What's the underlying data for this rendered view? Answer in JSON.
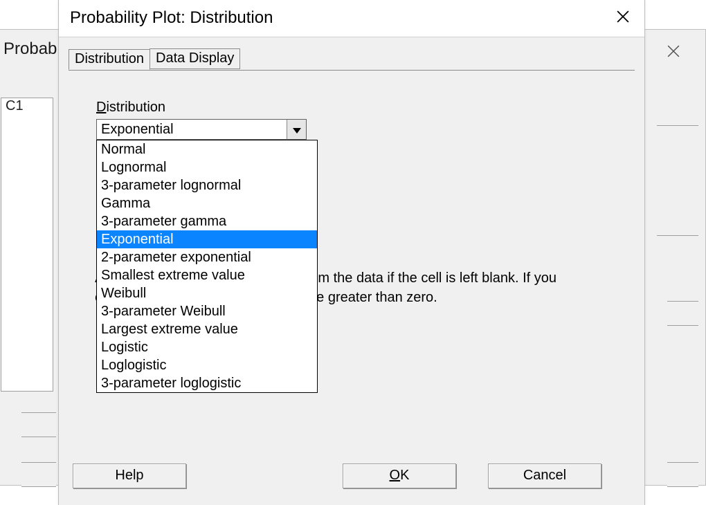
{
  "background": {
    "title_prefix": "Probab",
    "list_item": "C1"
  },
  "dialog": {
    "title": "Probability Plot: Distribution",
    "tabs": [
      {
        "label": "Distribution",
        "selected": true
      },
      {
        "label": "Data Display",
        "selected": false
      }
    ],
    "field_label_prefix": "D",
    "field_label_rest": "istribution",
    "selected_value": "Exponential",
    "options": [
      "Normal",
      "Lognormal",
      "3-parameter lognormal",
      "Gamma",
      "3-parameter gamma",
      "Exponential",
      "2-parameter exponential",
      "Smallest extreme value",
      "Weibull",
      "3-parameter Weibull",
      "Largest extreme value",
      "Logistic",
      "Loglogistic",
      "3-parameter loglogistic"
    ],
    "hint_line1": "A historical estimate is calculated from the data if the cell is left blank. If you",
    "hint_line2": "enter a shape or threshold, it must be greater than zero.",
    "buttons": {
      "help": "Help",
      "ok_underline": "O",
      "ok_rest": "K",
      "cancel": "Cancel"
    }
  }
}
